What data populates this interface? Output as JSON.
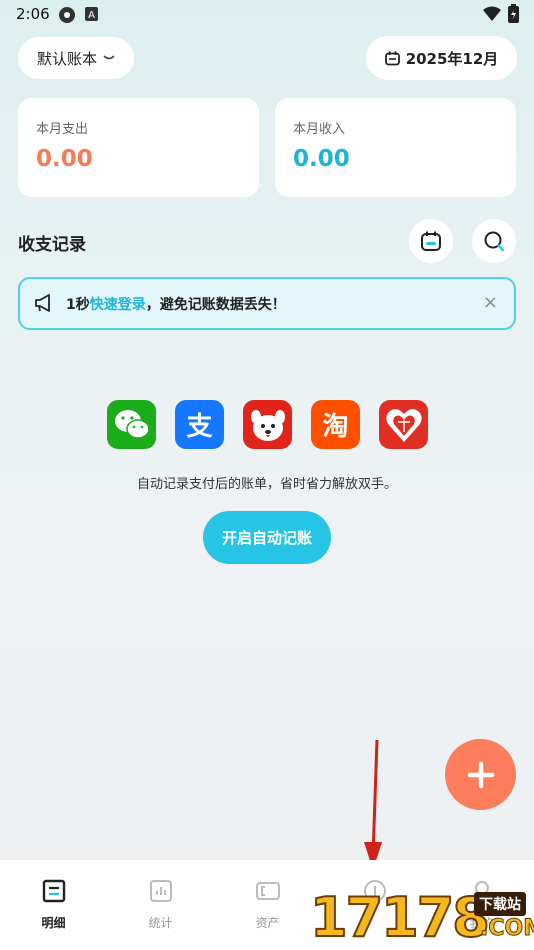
{
  "status": {
    "time": "2:06"
  },
  "header": {
    "book_label": "默认账本",
    "date_label": "2025年12月"
  },
  "summary": {
    "expense": {
      "label": "本月支出",
      "value": "0.00",
      "color": "#f47c56"
    },
    "income": {
      "label": "本月收入",
      "value": "0.00",
      "color": "#1cb4d9"
    }
  },
  "records": {
    "title": "收支记录"
  },
  "notice": {
    "prefix": "1秒",
    "link": "快速登录",
    "suffix": "，避免记账数据丢失！",
    "close": "×"
  },
  "auto": {
    "apps": [
      {
        "name": "wechat-icon",
        "color": "#1aad19"
      },
      {
        "name": "alipay-icon",
        "color": "#1677ff",
        "glyph": "支"
      },
      {
        "name": "jd-icon",
        "color": "#e1251b"
      },
      {
        "name": "taobao-icon",
        "color": "#ff5000",
        "glyph": "淘"
      },
      {
        "name": "pinduoduo-icon",
        "color": "#e02e24"
      }
    ],
    "description": "自动记录支付后的账单，省时省力解放双手。",
    "button": "开启自动记账"
  },
  "tabs": [
    {
      "label": "明细",
      "icon": "list-icon",
      "active": true
    },
    {
      "label": "统计",
      "icon": "chart-icon",
      "active": false
    },
    {
      "label": "资产",
      "icon": "wallet-icon",
      "active": false
    },
    {
      "label": "",
      "icon": "coin-icon",
      "active": false
    },
    {
      "label": "我的",
      "icon": "profile-icon",
      "active": false
    }
  ],
  "watermark": {
    "digits": "17178",
    "badge": "下载站",
    "domain": ".COM"
  }
}
